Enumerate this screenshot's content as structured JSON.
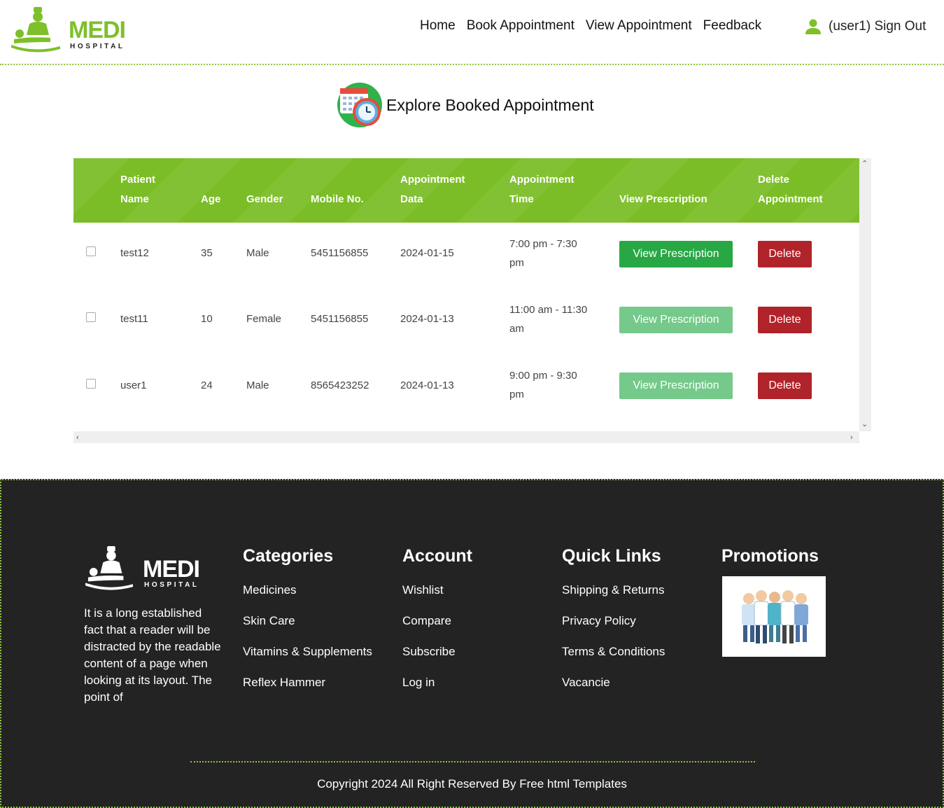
{
  "brand": {
    "name": "MEDI",
    "sub": "HOSPITAL",
    "color": "#7dc02a"
  },
  "nav": {
    "home": "Home",
    "book": "Book Appointment",
    "view": "View Appointment",
    "feedback": "Feedback"
  },
  "user": {
    "label": "(user1) Sign Out"
  },
  "page_title": "Explore Booked Appointment",
  "table": {
    "headers": {
      "name_l1": "Patient",
      "name_l2": "Name",
      "age": "Age",
      "gender": "Gender",
      "mobile": "Mobile No.",
      "date_l1": "Appointment",
      "date_l2": "Data",
      "time_l1": "Appointment",
      "time_l2": "Time",
      "view": "View Prescription",
      "del_l1": "Delete",
      "del_l2": "Appointment"
    },
    "rows": [
      {
        "name": "test12",
        "age": "35",
        "gender": "Male",
        "mobile": "5451156855",
        "date": "2024-01-15",
        "time_l1": "7:00 pm - 7:30",
        "time_l2": "pm",
        "view_label": "View Prescription",
        "delete_label": "Delete",
        "view_enabled": true
      },
      {
        "name": "test11",
        "age": "10",
        "gender": "Female",
        "mobile": "5451156855",
        "date": "2024-01-13",
        "time_l1": "11:00 am - 11:30",
        "time_l2": "am",
        "view_label": "View Prescription",
        "delete_label": "Delete",
        "view_enabled": false
      },
      {
        "name": "user1",
        "age": "24",
        "gender": "Male",
        "mobile": "8565423252",
        "date": "2024-01-13",
        "time_l1": "9:00 pm - 9:30",
        "time_l2": "pm",
        "view_label": "View Prescription",
        "delete_label": "Delete",
        "view_enabled": false
      }
    ]
  },
  "colors": {
    "header_green": "#7bbd27",
    "view_active": "#28a745",
    "view_disabled": "#75c98a",
    "delete": "#b0232a",
    "footer_bg": "#232323"
  },
  "footer": {
    "about": "It is a long established fact that a reader will be distracted by the readable content of a page when looking at its layout. The point of",
    "categories": {
      "title": "Categories",
      "items": [
        "Medicines",
        "Skin Care",
        "Vitamins & Supplements",
        "Reflex Hammer"
      ]
    },
    "account": {
      "title": "Account",
      "items": [
        "Wishlist",
        "Compare",
        "Subscribe",
        "Log in"
      ]
    },
    "quick": {
      "title": "Quick Links",
      "items": [
        "Shipping & Returns",
        "Privacy Policy",
        "Terms & Conditions",
        "Vacancie"
      ]
    },
    "promotions": {
      "title": "Promotions",
      "image": "doctors-group-illustration"
    },
    "copyright": "Copyright 2024 All Right Reserved By Free html Templates"
  }
}
